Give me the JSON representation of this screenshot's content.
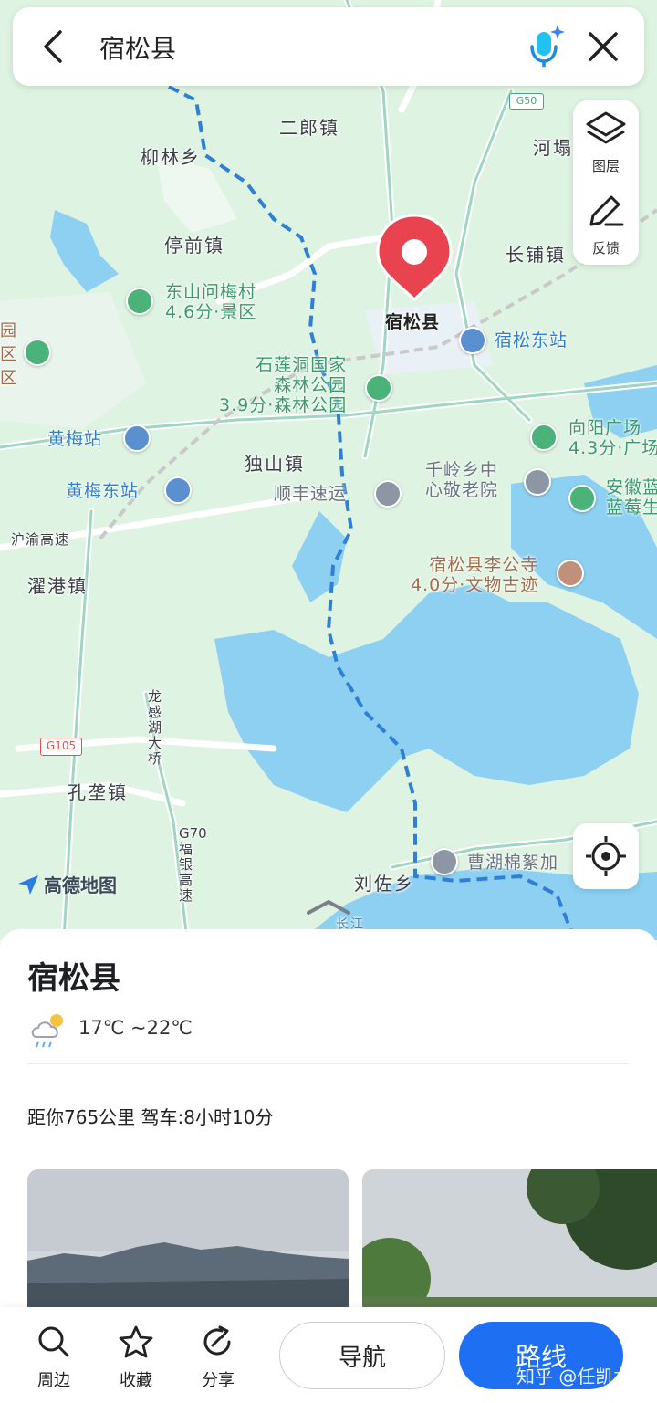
{
  "search": {
    "query": "宿松县"
  },
  "tools": {
    "layers_label": "图层",
    "feedback_label": "反馈"
  },
  "map": {
    "logo_text": "高德地图",
    "pin_label": "宿松县",
    "road_badges": {
      "g50": "G50",
      "g105": "G105"
    },
    "road_names": {
      "huyu": "沪渝高速",
      "longganhu": "龙感湖大桥",
      "g70": "G70福银高速",
      "river": "长江"
    },
    "labels": {
      "erlang": "二郎镇",
      "liulin": "柳林乡",
      "hechang": "河塌",
      "tingqian": "停前镇",
      "changpu": "长铺镇",
      "dushan": "独山镇",
      "zhuogang": "濯港镇",
      "kongleng": "孔垄镇",
      "liuzuo": "刘佐乡",
      "edge_a": "园",
      "edge_b": "区",
      "edge_c": "区"
    },
    "pois": {
      "dongshan_name": "东山问梅村",
      "dongshan_sub": "4.6分·景区",
      "shilian_name1": "石莲洞国家",
      "shilian_name2": "森林公园",
      "shilian_sub": "3.9分·森林公园",
      "susong_east": "宿松东站",
      "huangmei": "黄梅站",
      "huangmei_east": "黄梅东站",
      "shunfeng": "顺丰速运",
      "qianling1": "千岭乡中",
      "qianling2": "心敬老院",
      "xiangyang_name": "向阳广场",
      "xiangyang_sub": "4.3分·广场",
      "anhui1": "安徽蓝",
      "anhui2": "蓝莓生",
      "ligong_name": "宿松县李公寺",
      "ligong_sub": "4.0分·文物古迹",
      "caohu": "曹湖棉絮加"
    }
  },
  "place": {
    "title": "宿松县",
    "weather": "17℃ ~22℃",
    "distance": "距你765公里 驾车:8小时10分"
  },
  "actions": {
    "nearby": "周边",
    "favorite": "收藏",
    "share": "分享",
    "navigate": "导航",
    "route": "路线"
  },
  "watermark": "知乎 @任凯龙",
  "colors": {
    "primary": "#1f6ff2",
    "pin": "#e8434f",
    "water": "#8dd0f2",
    "land": "#dff3e2",
    "border": "#2f7fd8"
  }
}
